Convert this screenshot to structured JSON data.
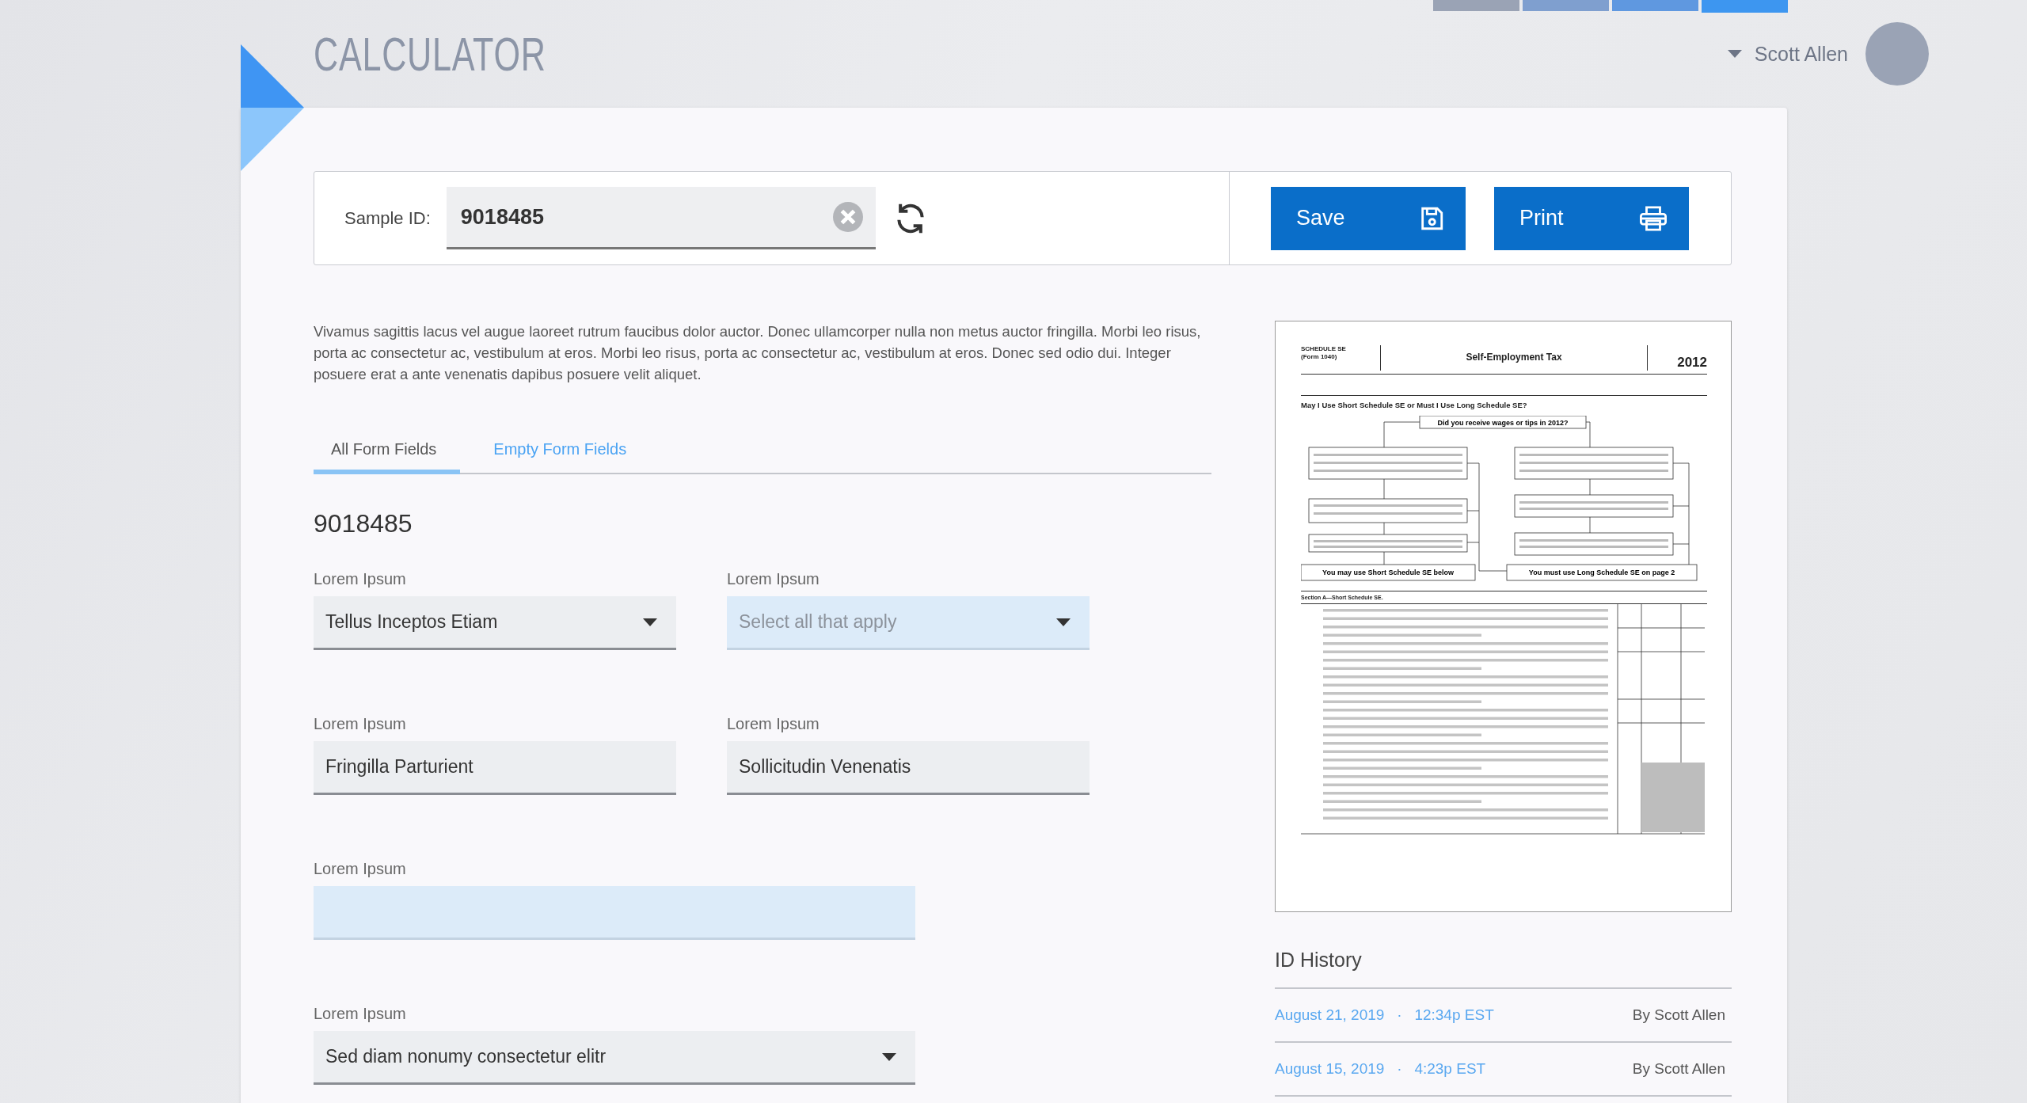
{
  "top_tabs": [
    {
      "color": "#9aa3b5",
      "selected": false
    },
    {
      "color": "#7f9fcf",
      "selected": false
    },
    {
      "color": "#5f98e0",
      "selected": false
    },
    {
      "color": "#3d96f0",
      "selected": true
    }
  ],
  "app_title": "CALCULATOR",
  "user": {
    "name": "Scott Allen"
  },
  "toolbar": {
    "label": "Sample ID:",
    "value": "9018485",
    "buttons": [
      {
        "label": "Save",
        "kind": "save"
      },
      {
        "label": "Print",
        "kind": "print"
      }
    ]
  },
  "intro": "Vivamus sagittis lacus vel augue laoreet rutrum faucibus dolor auctor. Donec ullamcorper nulla non metus auctor fringilla. Morbi leo risus, porta ac consectetur ac, vestibulum at eros. Morbi leo risus, porta ac consectetur ac, vestibulum at eros. Donec sed odio dui. Integer posuere erat a ante venenatis dapibus posuere velit aliquet.",
  "tabs": [
    {
      "label": "All Form Fields",
      "selected": true
    },
    {
      "label": "Empty Form Fields",
      "selected": false
    }
  ],
  "record_id": "9018485",
  "fields": [
    {
      "label": "Lorem Ipsum",
      "kind": "select",
      "value": "Tellus Inceptos Etiam",
      "highlighted": false,
      "wide": false
    },
    {
      "label": "Lorem Ipsum",
      "kind": "select",
      "placeholder": "Select all that apply",
      "highlighted": true,
      "wide": false
    },
    {
      "label": "Lorem Ipsum",
      "kind": "text",
      "value": "Fringilla Parturient",
      "highlighted": false,
      "wide": false
    },
    {
      "label": "Lorem Ipsum",
      "kind": "text",
      "value": "Sollicitudin Venenatis",
      "highlighted": false,
      "wide": false
    },
    {
      "label": "Lorem Ipsum",
      "kind": "text",
      "highlighted": true,
      "wide": true
    },
    {
      "label": "Lorem Ipsum",
      "kind": "select",
      "value": "Sed diam nonumy consectetur elitr",
      "highlighted": false,
      "wide": true
    }
  ],
  "document": {
    "schedule": "SCHEDULE SE",
    "form": "(Form 1040)",
    "title": "Self-Employment Tax",
    "year": "2012",
    "question": "May I Use Short Schedule SE or Must I Use Long Schedule SE?",
    "flow_start": "Did you receive wages or tips in 2012?",
    "flow_short": "You may use Short Schedule SE below",
    "flow_long": "You must use Long Schedule SE on page 2",
    "section": "Section A—Short Schedule SE."
  },
  "history": {
    "title": "ID History",
    "entries": [
      {
        "date": "August 21, 2019",
        "separator": "·",
        "time": "12:34p EST",
        "author": "By Scott Allen"
      },
      {
        "date": "August 15, 2019",
        "separator": "·",
        "time": "4:23p EST",
        "author": "By Scott Allen"
      }
    ]
  }
}
